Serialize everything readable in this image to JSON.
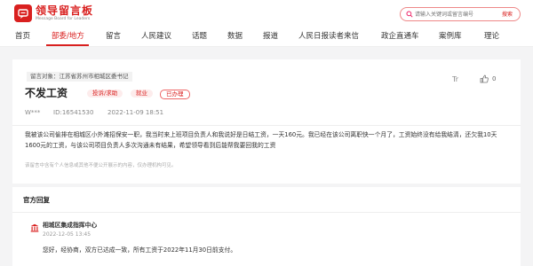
{
  "brand": {
    "title": "领导留言板",
    "subtitle": "Message Board for Leaders",
    "color": "#d9201f"
  },
  "search": {
    "placeholder": "请输入关键词或留言编号",
    "button_label": "搜索"
  },
  "nav": {
    "items": [
      {
        "label": "首页",
        "active": false
      },
      {
        "label": "部委/地方",
        "active": true
      },
      {
        "label": "留言",
        "active": false
      },
      {
        "label": "人民建议",
        "active": false
      },
      {
        "label": "话题",
        "active": false
      },
      {
        "label": "数据",
        "active": false
      },
      {
        "label": "报道",
        "active": false
      },
      {
        "label": "人民日报读者来信",
        "active": false
      },
      {
        "label": "政企直通车",
        "active": false
      },
      {
        "label": "案例库",
        "active": false
      },
      {
        "label": "理论",
        "active": false
      }
    ]
  },
  "message": {
    "target_label": "留言对象",
    "target": "江苏省苏州市相城区委书记",
    "title": "不发工资",
    "tags": {
      "type": "投诉/求助",
      "field": "就业",
      "status": "已办理"
    },
    "font_toggle": "Tr",
    "likes": "0",
    "user": "W***",
    "id_label": "ID:",
    "id": "16541530",
    "date": "2022-11-09 18:51",
    "content": "我被该公司偷排在相城区小外滩招保安一职，我当时来上班项目负责人和我说好是日结工资，一天160元。我已经在该公司离职快一个月了，工资始终没有给我结清，还欠我10天1600元的工资，与该公司项目负责人多次沟通未有结果，希望领导看到后能帮我要回我的工资",
    "note": "该留言中含有个人信息或其他不便公开展示的内容，仅办理机构可见。"
  },
  "reply": {
    "heading": "官方回复",
    "org": "相城区集成指挥中心",
    "date": "2022-12-05 13:45",
    "text": "您好，经协商，双方已达成一致，所有工资于2022年11月30日前支付。"
  }
}
